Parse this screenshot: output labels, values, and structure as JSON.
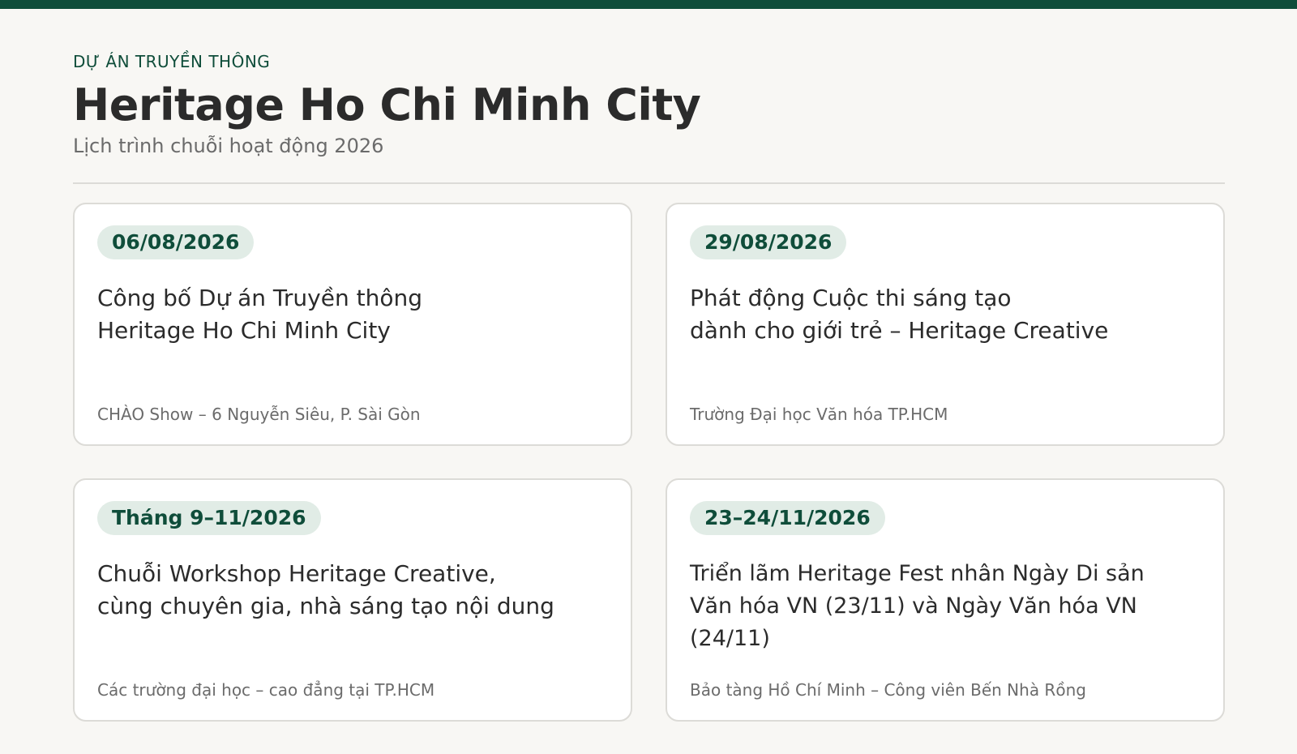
{
  "header": {
    "kicker": "DỰ ÁN TRUYỀN THÔNG",
    "title": "Heritage Ho Chi Minh City",
    "subtitle": "Lịch trình chuỗi hoạt động 2026"
  },
  "events": [
    {
      "date": "06/08/2026",
      "title": "Công bố Dự án Truyền thông\nHeritage Ho Chi Minh City",
      "location": "CHÀO Show – 6 Nguyễn Siêu, P. Sài Gòn"
    },
    {
      "date": "29/08/2026",
      "title": "Phát động Cuộc thi sáng tạo\ndành cho giới trẻ – Heritage Creative",
      "location": "Trường Đại học Văn hóa TP.HCM"
    },
    {
      "date": "Tháng 9–11/2026",
      "title": "Chuỗi Workshop Heritage Creative,\ncùng chuyên gia, nhà sáng tạo nội dung",
      "location": "Các trường đại học – cao đẳng tại TP.HCM"
    },
    {
      "date": "23–24/11/2026",
      "title": "Triển lãm Heritage Fest nhân Ngày Di sản\nVăn hóa VN (23/11) và Ngày Văn hóa VN (24/11)",
      "location": "Bảo tàng Hồ Chí Minh – Công viên Bến Nhà Rồng"
    }
  ],
  "colors": {
    "accent": "#0f4d3a",
    "badge_bg": "#e1ece6",
    "background": "#f8f7f4",
    "card_border": "#dcdbd7"
  }
}
